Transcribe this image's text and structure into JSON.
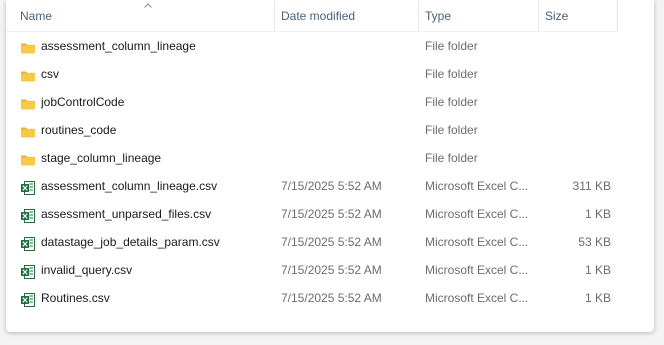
{
  "columns": {
    "name": "Name",
    "date": "Date modified",
    "type": "Type",
    "size": "Size"
  },
  "rows": [
    {
      "name": "assessment_column_lineage",
      "date": "",
      "type": "File folder",
      "size": "",
      "icon": "folder-icon"
    },
    {
      "name": "csv",
      "date": "",
      "type": "File folder",
      "size": "",
      "icon": "folder-icon"
    },
    {
      "name": "jobControlCode",
      "date": "",
      "type": "File folder",
      "size": "",
      "icon": "folder-icon"
    },
    {
      "name": "routines_code",
      "date": "",
      "type": "File folder",
      "size": "",
      "icon": "folder-icon"
    },
    {
      "name": "stage_column_lineage",
      "date": "",
      "type": "File folder",
      "size": "",
      "icon": "folder-icon"
    },
    {
      "name": "assessment_column_lineage.csv",
      "date": "7/15/2025 5:52 AM",
      "type": "Microsoft Excel C...",
      "size": "311 KB",
      "icon": "excel-csv-icon"
    },
    {
      "name": "assessment_unparsed_files.csv",
      "date": "7/15/2025 5:52 AM",
      "type": "Microsoft Excel C...",
      "size": "1 KB",
      "icon": "excel-csv-icon"
    },
    {
      "name": "datastage_job_details_param.csv",
      "date": "7/15/2025 5:52 AM",
      "type": "Microsoft Excel C...",
      "size": "53 KB",
      "icon": "excel-csv-icon"
    },
    {
      "name": "invalid_query.csv",
      "date": "7/15/2025 5:52 AM",
      "type": "Microsoft Excel C...",
      "size": "1 KB",
      "icon": "excel-csv-icon"
    },
    {
      "name": "Routines.csv",
      "date": "7/15/2025 5:52 AM",
      "type": "Microsoft Excel C...",
      "size": "1 KB",
      "icon": "excel-csv-icon"
    }
  ],
  "colors": {
    "folder": "#f8c948",
    "excel": "#1d6f42",
    "header_text": "#4c607a"
  }
}
